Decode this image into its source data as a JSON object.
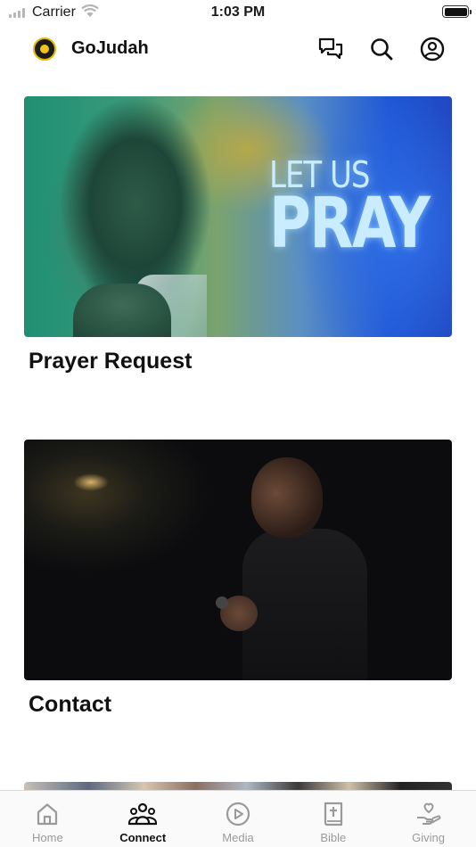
{
  "status_bar": {
    "carrier": "Carrier",
    "time": "1:03 PM"
  },
  "header": {
    "app_name": "GoJudah",
    "logo_icon": "lion-emblem-icon",
    "actions": [
      {
        "icon": "chat-bubbles-icon"
      },
      {
        "icon": "search-icon"
      },
      {
        "icon": "profile-icon"
      }
    ]
  },
  "cards": [
    {
      "title": "Prayer Request",
      "image_text_small": "LET US",
      "image_text_big": "PRAY"
    },
    {
      "title": "Contact"
    }
  ],
  "tab_bar": {
    "active": "Connect",
    "tabs": [
      {
        "label": "Home",
        "icon": "home-icon"
      },
      {
        "label": "Connect",
        "icon": "people-group-icon"
      },
      {
        "label": "Media",
        "icon": "play-circle-icon"
      },
      {
        "label": "Bible",
        "icon": "bible-icon"
      },
      {
        "label": "Giving",
        "icon": "giving-hand-icon"
      }
    ]
  },
  "colors": {
    "active_tab": "#111111",
    "inactive_tab": "#9a9a9a",
    "background": "#ffffff"
  }
}
